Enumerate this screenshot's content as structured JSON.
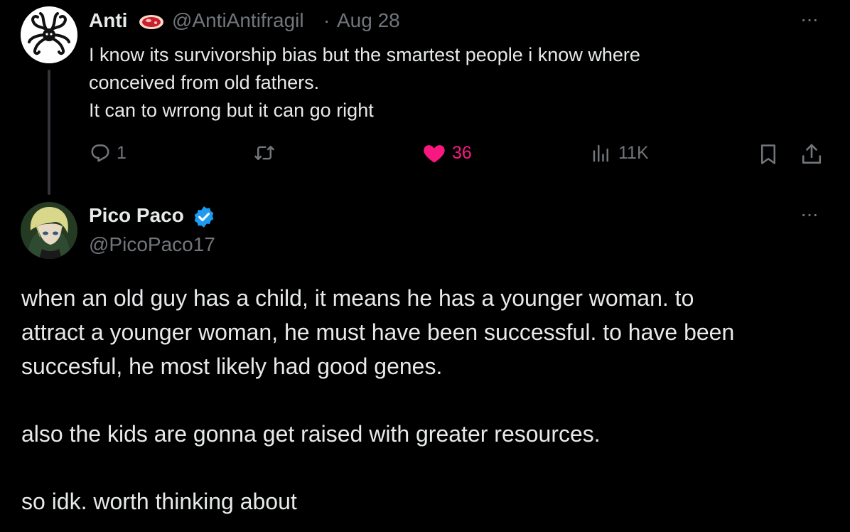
{
  "parent_tweet": {
    "author_name": "Anti",
    "author_emoji": "steak-emoji",
    "handle": "@AntiAntifragil",
    "separator": "·",
    "date": "Aug 28",
    "more": "···",
    "text_lines": [
      "I know its survivorship bias but the smartest people i know where",
      "conceived from old fathers.",
      "It can to wrrong but it can go right"
    ],
    "actions": {
      "reply_count": "1",
      "retweet_count": "",
      "like_count": "36",
      "view_count": "11K"
    },
    "colors": {
      "like": "#f91880",
      "muted": "#71767b",
      "text": "#e7e9ea"
    }
  },
  "reply_tweet": {
    "author_name": "Pico Paco",
    "verified": true,
    "handle": "@PicoPaco17",
    "more": "···",
    "paragraphs": [
      [
        "when an old guy has a child, it means he has a younger woman. to",
        "attract a younger woman, he must have been successful. to have been",
        "succesful, he most likely had good genes."
      ],
      [
        "also the kids are gonna get raised with greater resources."
      ],
      [
        "so idk. worth thinking about"
      ]
    ],
    "colors": {
      "verified": "#1d9bf0"
    }
  }
}
